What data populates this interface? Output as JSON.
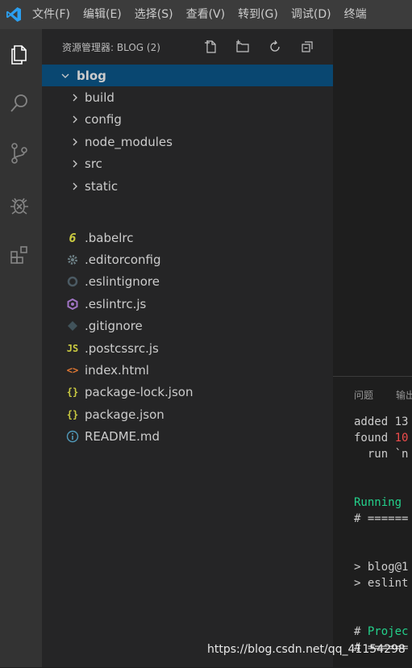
{
  "menubar": {
    "items": [
      "文件(F)",
      "编辑(E)",
      "选择(S)",
      "查看(V)",
      "转到(G)",
      "调试(D)",
      "终端"
    ]
  },
  "activity_bar": {
    "icons": [
      "files-icon",
      "search-icon",
      "source-control-icon",
      "debug-icon",
      "extensions-icon"
    ]
  },
  "sidebar": {
    "title": "资源管理器: BLOG (2)",
    "actions": [
      "new-file-icon",
      "new-folder-icon",
      "refresh-icon",
      "collapse-all-icon"
    ],
    "root": "blog",
    "folders": [
      "build",
      "config",
      "node_modules",
      "src",
      "static"
    ],
    "files": [
      {
        "name": ".babelrc",
        "icon": "6",
        "color": "#cbcb41"
      },
      {
        "name": ".editorconfig",
        "icon": "gear",
        "color": "#6d8086"
      },
      {
        "name": ".eslintignore",
        "icon": "circle",
        "color": "#4b5a63"
      },
      {
        "name": ".eslintrc.js",
        "icon": "hex",
        "color": "#a074c4"
      },
      {
        "name": ".gitignore",
        "icon": "diamond",
        "color": "#41535b"
      },
      {
        "name": ".postcssrc.js",
        "icon": "JS",
        "color": "#cbcb41"
      },
      {
        "name": "index.html",
        "icon": "<>",
        "color": "#e37933"
      },
      {
        "name": "package-lock.json",
        "icon": "{}",
        "color": "#cbcb41"
      },
      {
        "name": "package.json",
        "icon": "{}",
        "color": "#cbcb41"
      },
      {
        "name": "README.md",
        "icon": "i",
        "color": "#519aba"
      }
    ]
  },
  "panel": {
    "tabs": [
      "问题",
      "输出"
    ],
    "lines": [
      {
        "text": "added 13",
        "color": "#cccccc"
      },
      {
        "text": "found ",
        "color": "#cccccc",
        "extra": "10",
        "extra_color": "#f14c4c"
      },
      {
        "text": "  run `n",
        "color": "#cccccc"
      },
      {
        "text": "",
        "color": "#cccccc"
      },
      {
        "text": "",
        "color": "#cccccc"
      },
      {
        "text": "Running ",
        "color": "#23d18b"
      },
      {
        "text": "# ======",
        "color": "#cccccc"
      },
      {
        "text": "",
        "color": "#cccccc"
      },
      {
        "text": "",
        "color": "#cccccc"
      },
      {
        "text": "> blog@1",
        "color": "#cccccc"
      },
      {
        "text": "> eslint",
        "color": "#cccccc"
      },
      {
        "text": "",
        "color": "#cccccc"
      },
      {
        "text": "",
        "color": "#cccccc"
      },
      {
        "text": "# ",
        "color": "#cccccc",
        "extra": "Projec",
        "extra_color": "#23d18b"
      },
      {
        "text": "# ======",
        "color": "#cccccc"
      }
    ]
  },
  "watermark": "https://blog.csdn.net/qq_41154298"
}
